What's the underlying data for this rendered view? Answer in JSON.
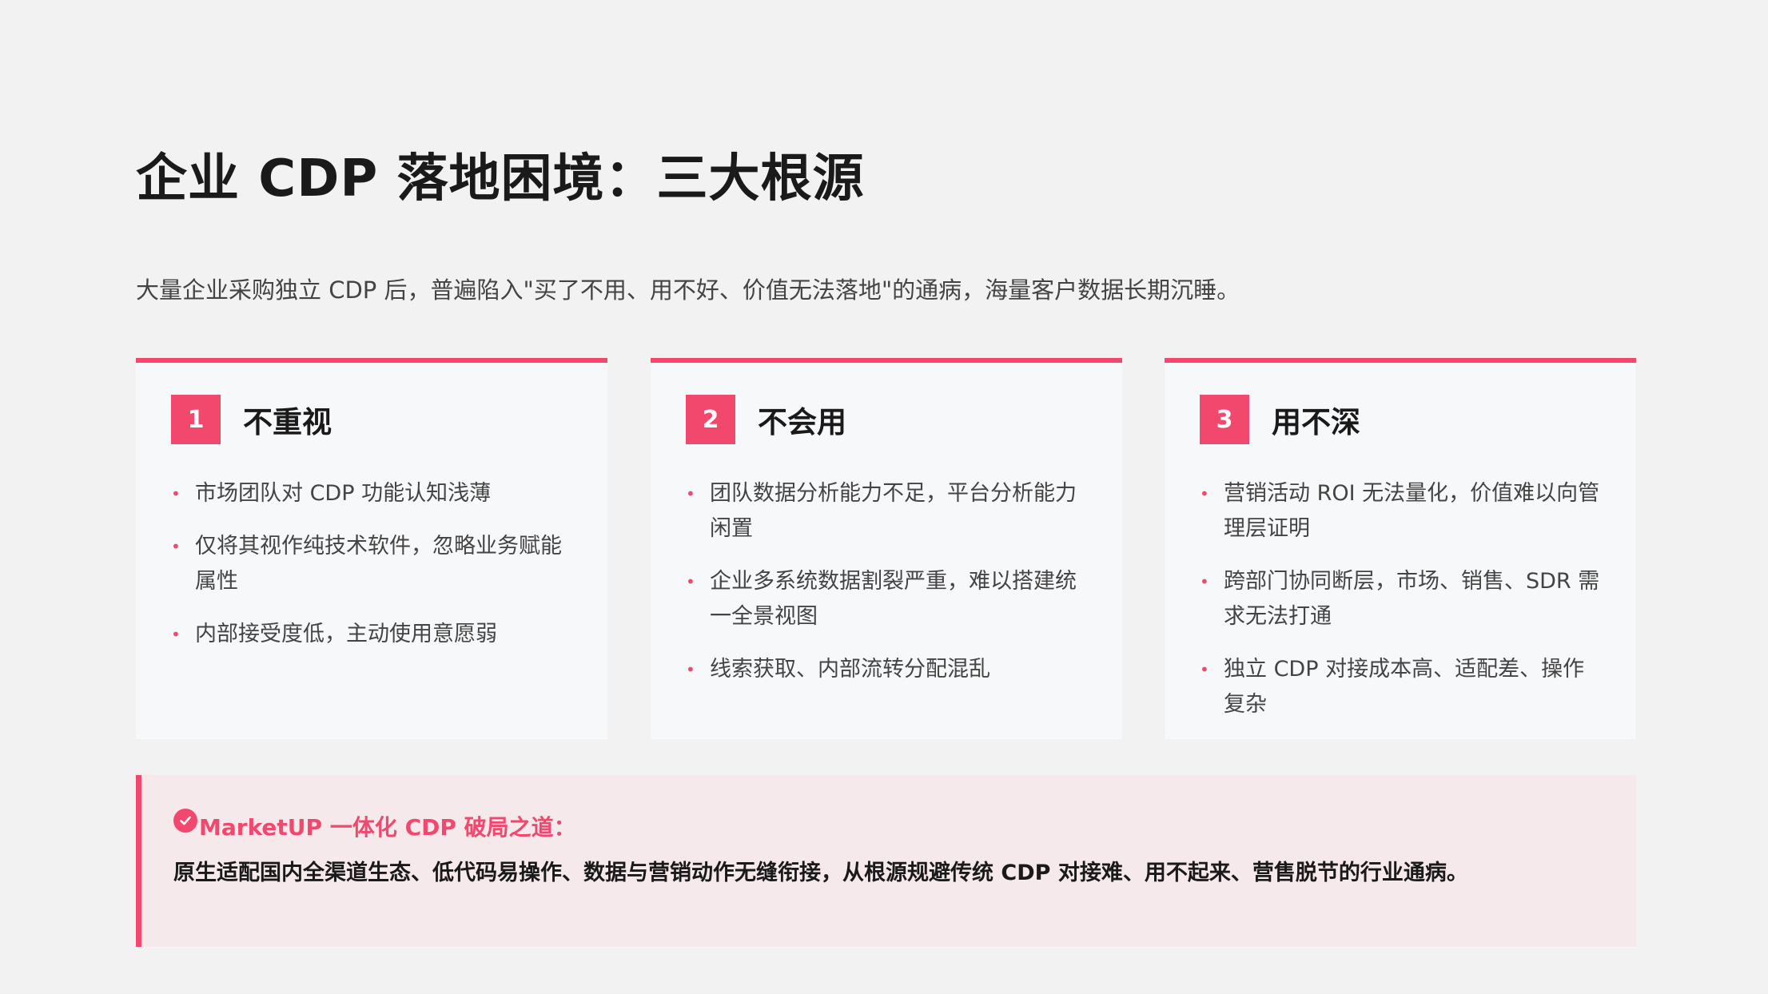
{
  "header": {
    "title": "企业 CDP 落地困境：三大根源",
    "subtitle": "大量企业采购独立 CDP 后，普遍陷入\"买了不用、用不好、价值无法落地\"的通病，海量客户数据长期沉睡。"
  },
  "cards": [
    {
      "number": "1",
      "title": "不重视",
      "points": [
        "市场团队对 CDP 功能认知浅薄",
        "仅将其视作纯技术软件，忽略业务赋能属性",
        "内部接受度低，主动使用意愿弱"
      ]
    },
    {
      "number": "2",
      "title": "不会用",
      "points": [
        "团队数据分析能力不足，平台分析能力闲置",
        "企业多系统数据割裂严重，难以搭建统一全景视图",
        "线索获取、内部流转分配混乱"
      ]
    },
    {
      "number": "3",
      "title": "用不深",
      "points": [
        "营销活动 ROI 无法量化，价值难以向管理层证明",
        "跨部门协同断层，市场、销售、SDR 需求无法打通",
        "独立 CDP 对接成本高、适配差、操作复杂"
      ]
    }
  ],
  "solution": {
    "icon": "check-circle-icon",
    "title": "MarketUP 一体化 CDP 破局之道：",
    "body": "原生适配国内全渠道生态、低代码易操作、数据与营销动作无缝衔接，从根源规避传统 CDP 对接难、用不起来、营售脱节的行业通病。"
  },
  "colors": {
    "accent": "#f2486d",
    "card_bg": "#f7f8fa",
    "solution_bg": "#f5e9eb",
    "page_bg": "#f2f2f2"
  }
}
